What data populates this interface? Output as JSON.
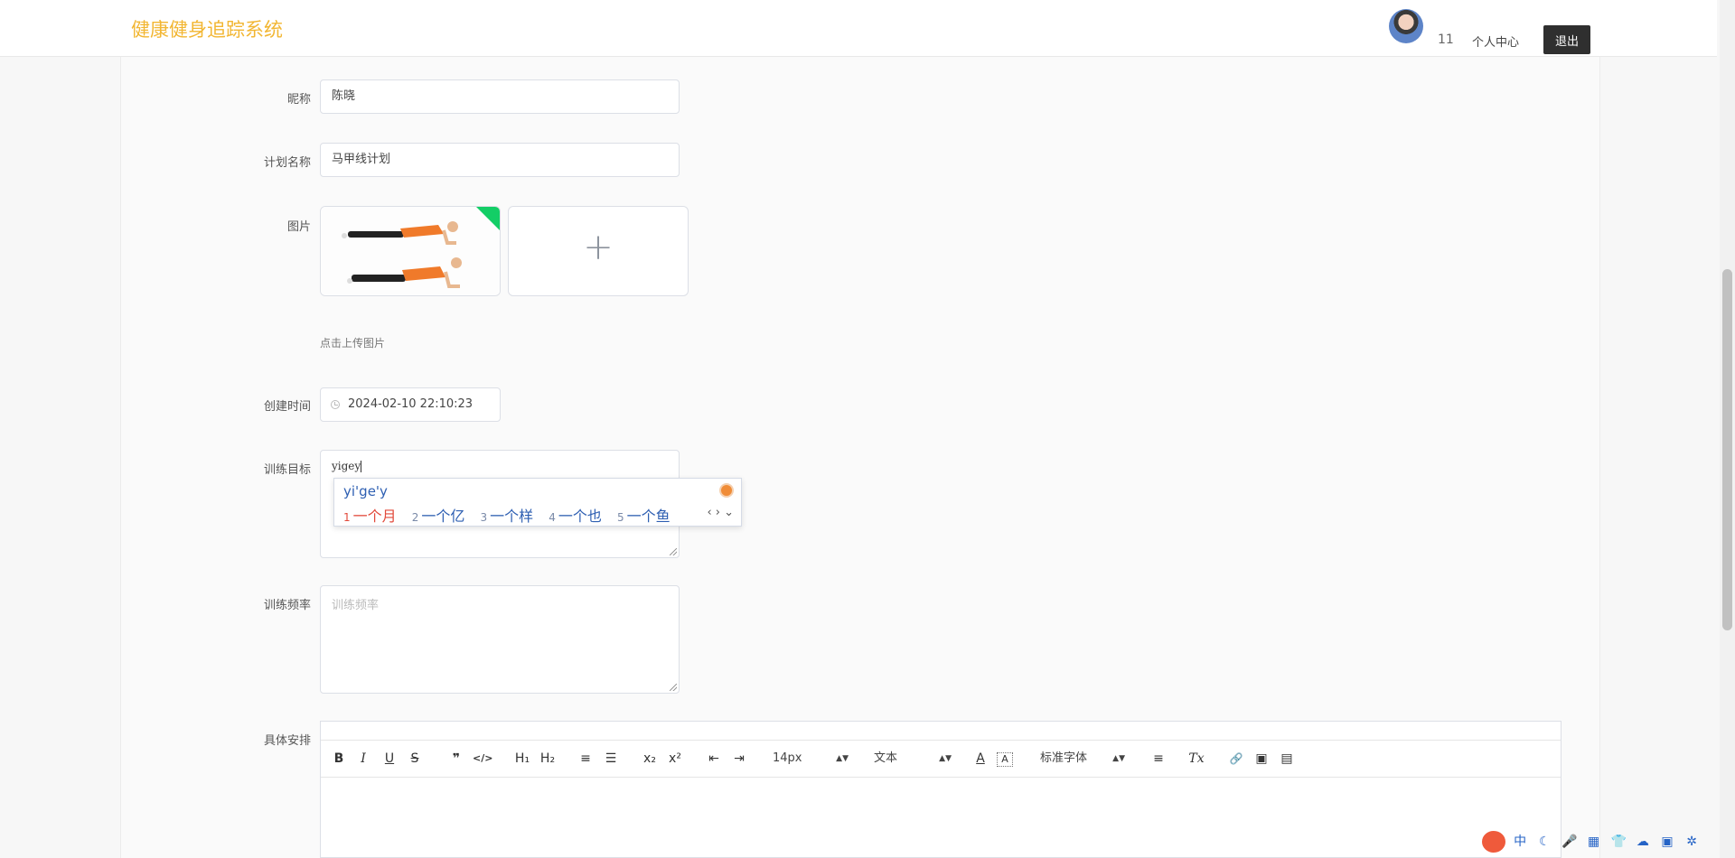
{
  "header": {
    "brand": "健康健身追踪系统",
    "username": "11",
    "personal_center": "个人中心",
    "logout": "退出"
  },
  "form": {
    "nickname": {
      "label": "昵称",
      "value": "陈晓"
    },
    "plan_name": {
      "label": "计划名称",
      "value": "马甲线计划"
    },
    "image": {
      "label": "图片",
      "hint": "点击上传图片",
      "upload_plus": "+"
    },
    "created_time": {
      "label": "创建时间",
      "value": "2024-02-10 22:10:23"
    },
    "goal": {
      "label": "训练目标",
      "value": "yigey"
    },
    "frequency": {
      "label": "训练频率",
      "placeholder": "训练频率"
    },
    "schedule": {
      "label": "具体安排"
    }
  },
  "ime": {
    "composition": "yi'ge'y",
    "candidates": [
      {
        "n": "1",
        "text": "一个月"
      },
      {
        "n": "2",
        "text": "一个亿"
      },
      {
        "n": "3",
        "text": "一个样"
      },
      {
        "n": "4",
        "text": "一个也"
      },
      {
        "n": "5",
        "text": "一个鱼"
      }
    ],
    "nav": "‹ › ⌄"
  },
  "editor": {
    "toolbar": {
      "bold": "B",
      "italic": "I",
      "underline": "U",
      "strike": "S",
      "quote": "❞",
      "code": "</>",
      "h1": "H₁",
      "h2": "H₂",
      "ordered_list": "≡",
      "bullet_list": "☰",
      "subscript": "x₂",
      "superscript": "x²",
      "outdent": "⇤",
      "indent": "⇥",
      "size": "14px",
      "header_select": "文本",
      "color": "A",
      "background": "A",
      "font_select": "标准字体",
      "align": "≡",
      "clean": "Tx",
      "link": "🔗",
      "image": "▣",
      "video": "▤"
    }
  },
  "tray": {
    "icons": [
      "中",
      "☾",
      "🎤",
      "▦",
      "👕",
      "☁",
      "▣",
      "✲"
    ]
  }
}
